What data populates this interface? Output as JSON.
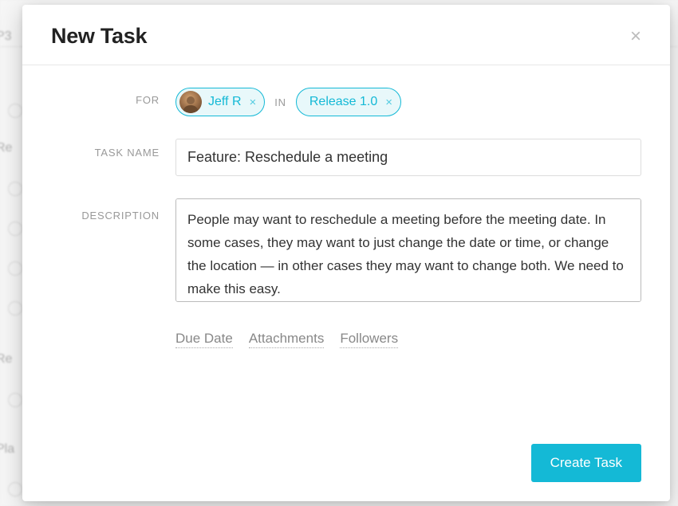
{
  "modal": {
    "title": "New Task"
  },
  "for": {
    "label": "FOR",
    "assignee": "Jeff R"
  },
  "in": {
    "label": "IN",
    "project": "Release 1.0"
  },
  "task_name": {
    "label": "TASK NAME",
    "value": "Feature: Reschedule a meeting"
  },
  "description": {
    "label": "DESCRIPTION",
    "value": "People may want to reschedule a meeting before the meeting date. In some cases, they may want to just change the date or time, or change the location — in other cases they may want to change both. We need to make this easy."
  },
  "links": {
    "due_date": "Due Date",
    "attachments": "Attachments",
    "followers": "Followers"
  },
  "buttons": {
    "create": "Create Task"
  },
  "background": {
    "item1": "Re",
    "item2": "Re",
    "item3": "Pla",
    "item0": "P3"
  }
}
